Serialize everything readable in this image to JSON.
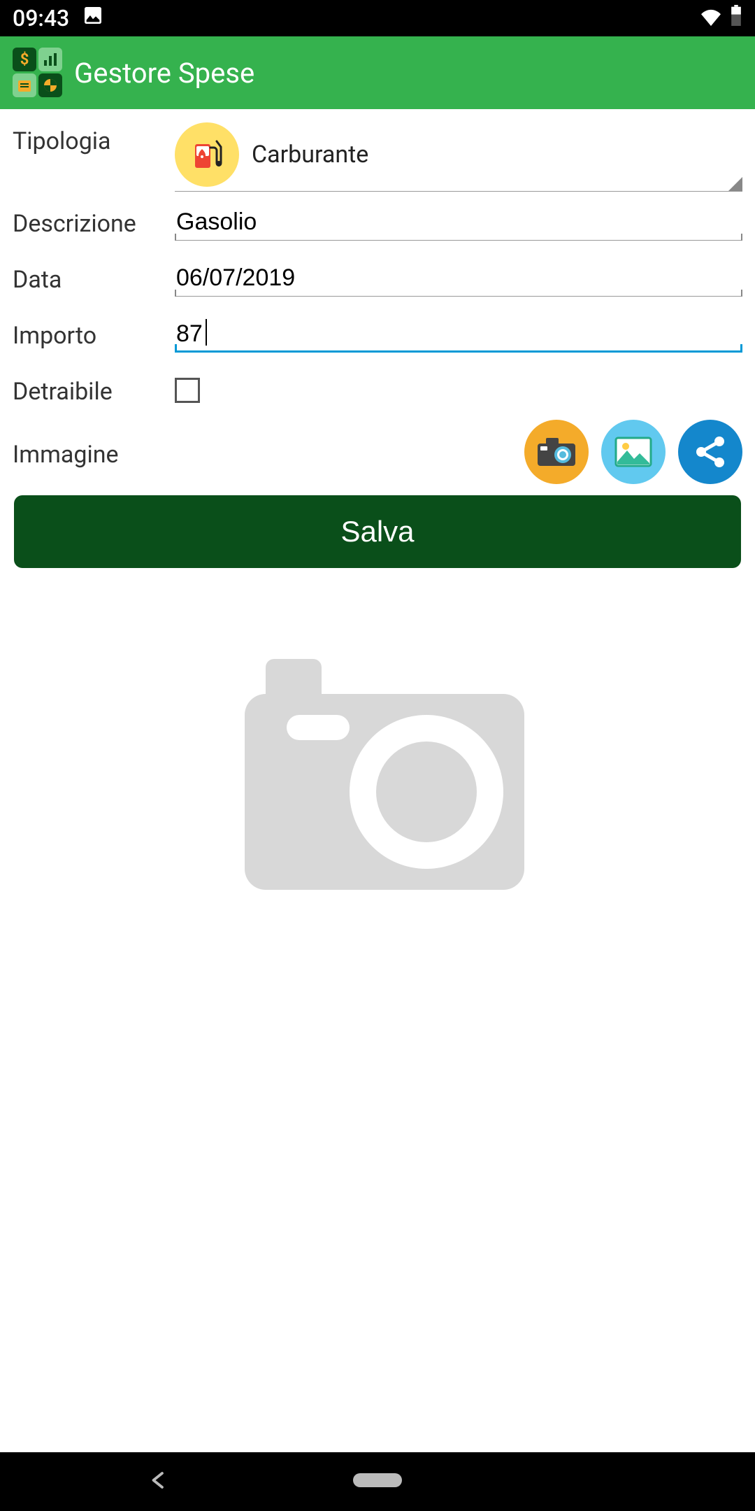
{
  "status": {
    "time": "09:43"
  },
  "app": {
    "title": "Gestore Spese"
  },
  "form": {
    "type_label": "Tipologia",
    "type_value": "Carburante",
    "description_label": "Descrizione",
    "description_value": "Gasolio",
    "date_label": "Data",
    "date_value": "06/07/2019",
    "amount_label": "Importo",
    "amount_value": "87",
    "deductible_label": "Detraibile",
    "deductible_checked": false,
    "image_label": "Immagine",
    "save_label": "Salva"
  }
}
